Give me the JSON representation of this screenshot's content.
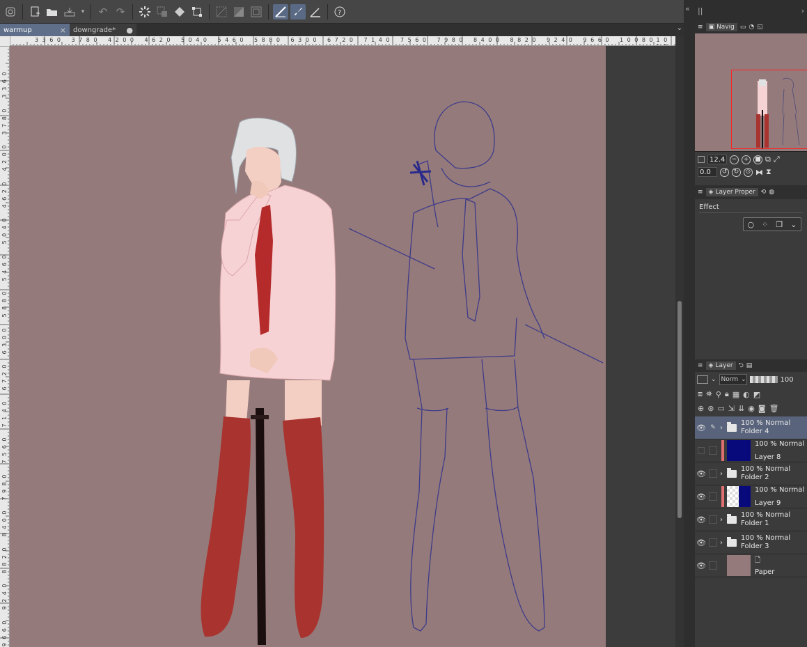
{
  "tabs": [
    {
      "label": "warmup",
      "active": true
    },
    {
      "label": "downgrade*",
      "active": false
    }
  ],
  "ruler_h": [
    "3 3 6 0",
    "3 7 8 0",
    "4 2 0 0",
    "4 6 2 0",
    "5 0 4 0",
    "5 4 6 0",
    "5 8 8 0",
    "6 3 0 0",
    "6 7 2 0",
    "7 1 4 0",
    "7 5 6 0",
    "7 9 8 0",
    "8 4 0 0",
    "8 8 2 0",
    "9 2 4 0",
    "9 6 6 0",
    "1 0 0 8 0",
    "1 0 5 0"
  ],
  "ruler_v": [
    "3 3 6 0",
    "3 7 8 0",
    "4 2 0 0",
    "4 6 2 0",
    "5 0 4 0",
    "5 4 6 0",
    "5 8 8 0",
    "6 3 0 0",
    "6 7 2 0",
    "7 1 4 0",
    "7 5 6 0",
    "7 9 8 0",
    "8 4 0 0",
    "8 8 2 0",
    "9 2 4 0",
    "9 6 6 0"
  ],
  "navigator": {
    "tab_label": "Navig",
    "zoom": "12.4",
    "angle": "0.0"
  },
  "layer_property": {
    "tab_label": "Layer Proper",
    "effect_label": "Effect"
  },
  "layer_panel": {
    "tab_label": "Layer",
    "blend_mode": "Norm",
    "opacity": "100"
  },
  "layers": [
    {
      "mode": "100 % Normal",
      "name": "Folder 4",
      "type": "folder",
      "visible": true,
      "selected": true,
      "editing": true
    },
    {
      "mode": "100 % Normal",
      "name": "Layer 8",
      "type": "layer",
      "visible": false,
      "selected": false,
      "editing": false
    },
    {
      "mode": "100 % Normal",
      "name": "Folder 2",
      "type": "folder",
      "visible": true,
      "selected": false,
      "editing": false
    },
    {
      "mode": "100 % Normal",
      "name": "Layer 9",
      "type": "layer",
      "visible": true,
      "selected": false,
      "editing": false
    },
    {
      "mode": "100 % Normal",
      "name": "Folder 1",
      "type": "folder",
      "visible": true,
      "selected": false,
      "editing": false
    },
    {
      "mode": "100 % Normal",
      "name": "Folder 3",
      "type": "folder",
      "visible": true,
      "selected": false,
      "editing": false
    },
    {
      "mode": "",
      "name": "Paper",
      "type": "paper",
      "visible": true,
      "selected": false,
      "editing": false
    }
  ],
  "colors": {
    "canvas": "#957a7b",
    "selection": "#59647c",
    "sketch": "#3d3b8a",
    "skirt": "#f7d2d4",
    "tie": "#b52a2a",
    "boots": "#a9332f"
  }
}
